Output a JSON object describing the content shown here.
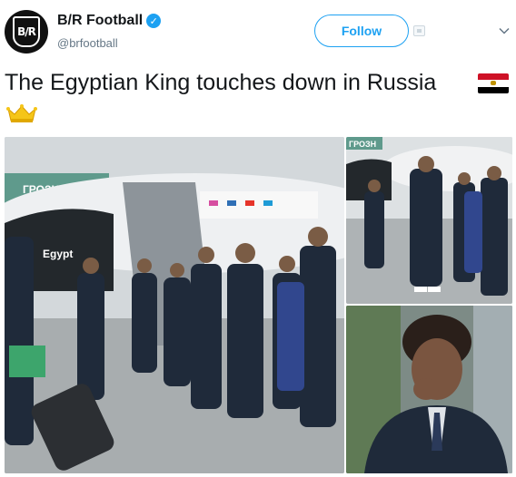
{
  "author": {
    "name": "B/R Football",
    "handle": "@brfootball",
    "avatar_text": "B/R",
    "verified_icon": "verified-badge-icon"
  },
  "actions": {
    "follow_label": "Follow"
  },
  "tweet": {
    "text": "The Egyptian King touches down in Russia",
    "emoji": [
      "egypt-flag-icon",
      "crown-icon"
    ]
  },
  "media": {
    "main": {
      "sign_text": "ГРОЗН",
      "plane_text": "Egypt"
    },
    "top_right": {
      "sign_text": "ГРОЗН"
    }
  },
  "colors": {
    "accent": "#1da1f2",
    "text": "#14171a",
    "secondary": "#657786"
  }
}
